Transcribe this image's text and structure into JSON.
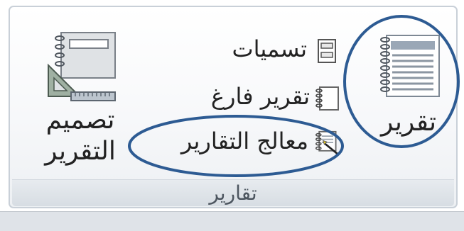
{
  "ribbon": {
    "group_label": "تقارير",
    "report": {
      "label": "تقرير",
      "icon": "report-icon"
    },
    "report_design": {
      "label_line1": "تصميم",
      "label_line2": "التقرير",
      "icon": "report-design-icon"
    },
    "labels": {
      "label": "تسميات",
      "icon": "labels-icon"
    },
    "blank_report": {
      "label": "تقرير فارغ",
      "icon": "blank-report-icon"
    },
    "report_wizard": {
      "label": "معالج التقارير",
      "icon": "report-wizard-icon"
    }
  },
  "colors": {
    "annotation": "#2d5b93",
    "group_border": "#c9d0d8",
    "text": "#222222"
  }
}
